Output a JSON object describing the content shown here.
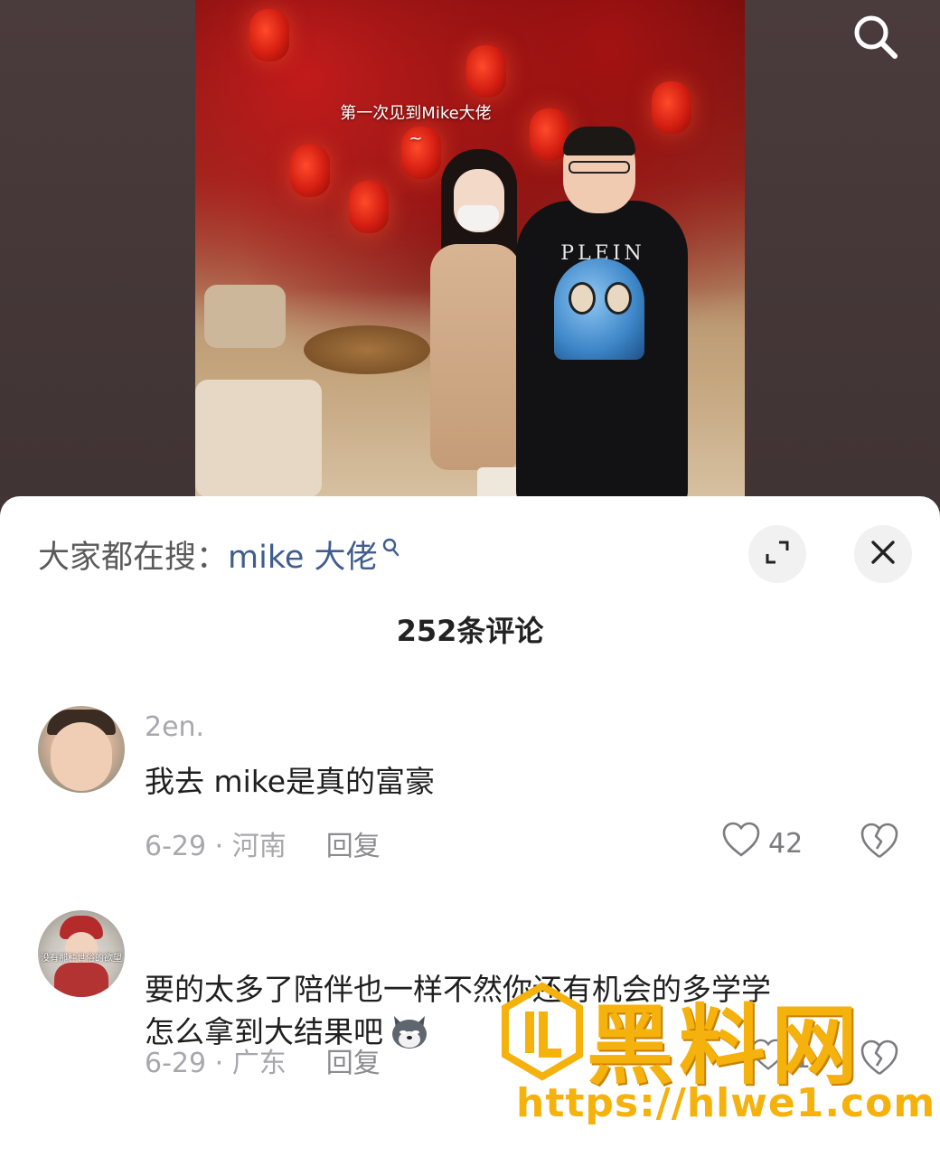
{
  "video": {
    "caption": "第一次见到Mike大佬",
    "caption_tilde": "~",
    "shirt_brand": "PLEIN"
  },
  "top_bar": {
    "search_icon": "search-icon"
  },
  "sheet": {
    "search_prefix": "大家都在搜：",
    "search_term": "mike 大佬",
    "expand_icon": "expand-icon",
    "close_icon": "close-icon",
    "comment_count_title": "252条评论"
  },
  "comments": [
    {
      "username": "2en.",
      "text": "我去 mike是真的富豪",
      "date_location": "6-29 · 河南",
      "reply_label": "回复",
      "likes": "42"
    },
    {
      "username": "",
      "avatar_text": "没有那种世俗的欲望",
      "text_line1": "要的太多了陪伴也一样不然你还有机会的多学学",
      "text_line2": "怎么拿到大结果吧",
      "date_location": "6-29 · 广东",
      "reply_label": "回复",
      "likes": "1"
    }
  ],
  "watermark": {
    "title": "黑料网",
    "url": "https://hlwe1.com"
  },
  "colors": {
    "search_term": "#3f5d8f",
    "muted": "#a7a7ad",
    "watermark": "#f5b10c"
  }
}
